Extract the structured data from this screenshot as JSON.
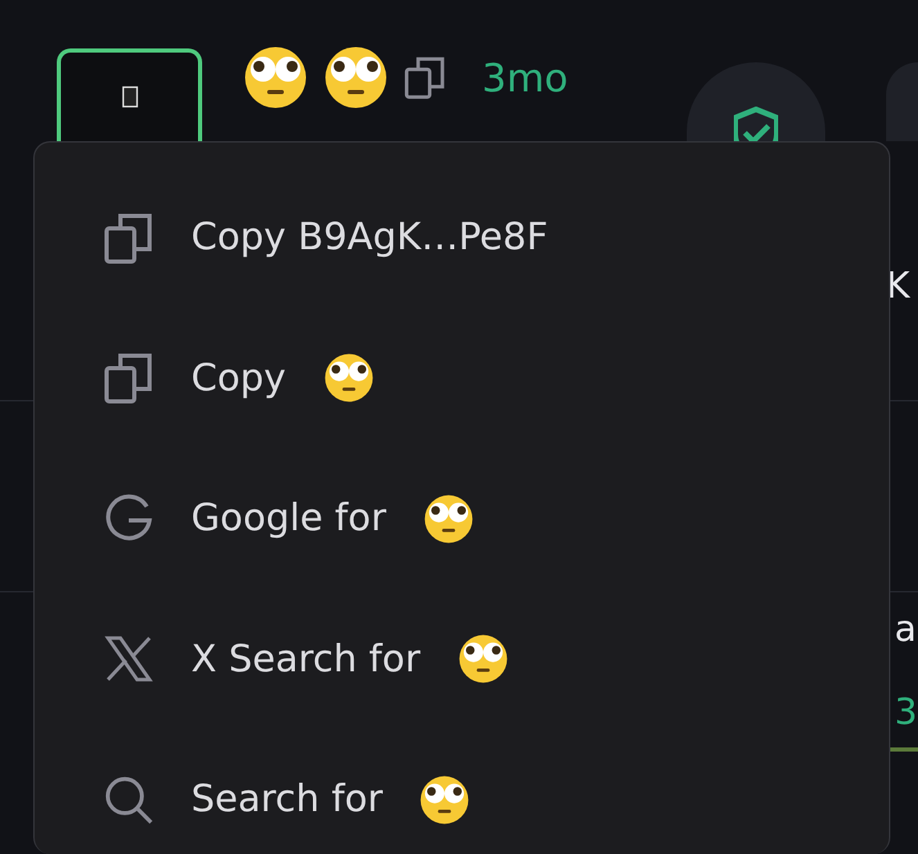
{
  "header": {
    "age": "3mo",
    "verified": true
  },
  "background_fragments": [
    {
      "text": "K",
      "kind": "title"
    },
    {
      "text": "a",
      "kind": "title"
    },
    {
      "text": "3",
      "kind": "green"
    }
  ],
  "menu": {
    "items": [
      {
        "kind": "copy",
        "label": "Copy B9AgK…Pe8F",
        "emoji": false
      },
      {
        "kind": "copy",
        "label": "Copy",
        "emoji": true
      },
      {
        "kind": "google",
        "label": "Google for",
        "emoji": true
      },
      {
        "kind": "x",
        "label": "X Search for",
        "emoji": true
      },
      {
        "kind": "search",
        "label": "Search for",
        "emoji": true
      }
    ]
  }
}
